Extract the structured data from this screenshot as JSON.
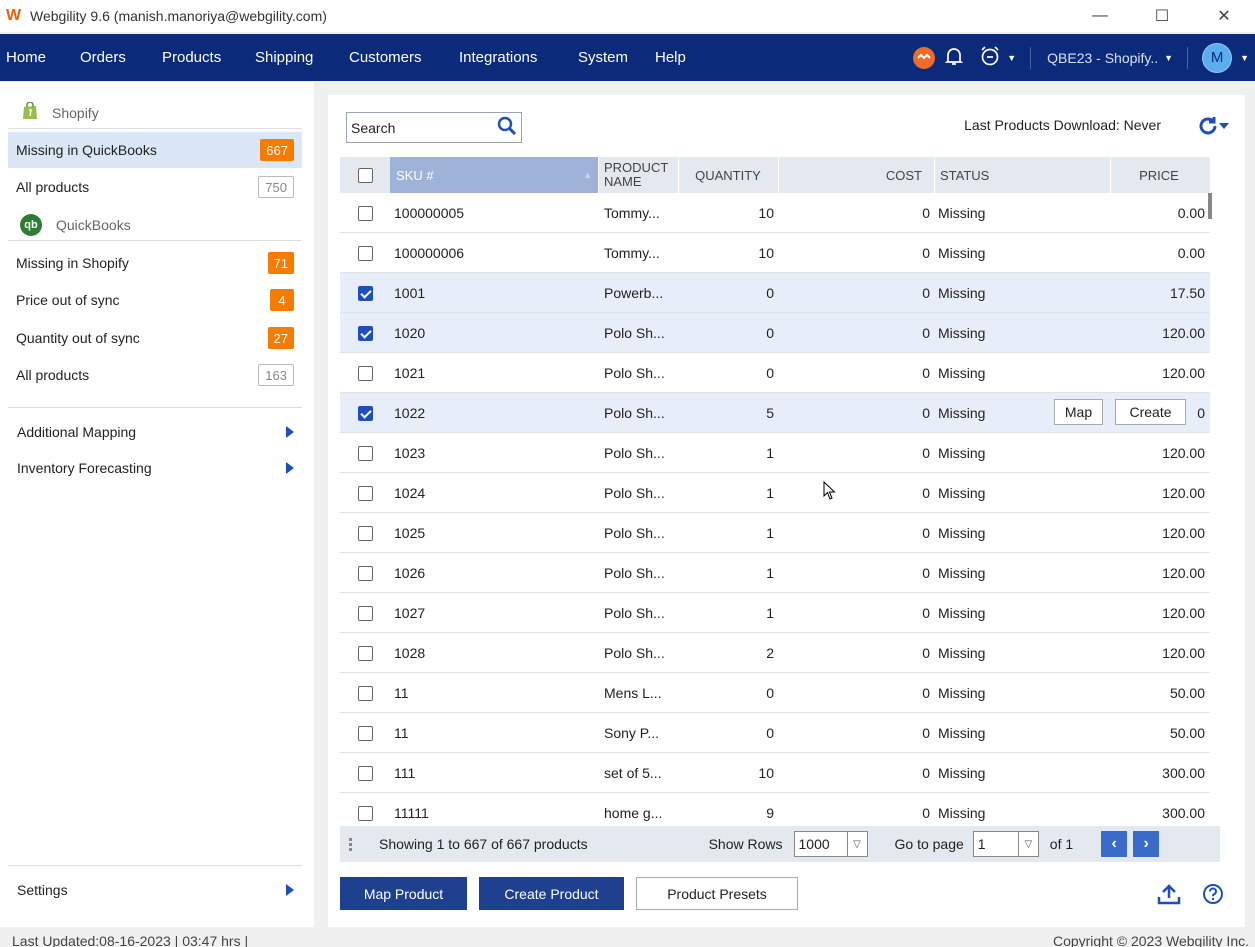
{
  "window": {
    "title": "Webgility 9.6 (manish.manoriya@webgility.com)",
    "minimize": "—",
    "maximize": "☐",
    "close": "✕"
  },
  "nav": {
    "items": [
      "Home",
      "Orders",
      "Products",
      "Shipping",
      "Customers",
      "Integrations",
      "System",
      "Help"
    ],
    "company": "QBE23 - Shopify..",
    "avatar": "M"
  },
  "sidebar": {
    "shopify_header": "Shopify",
    "quickbooks_header": "QuickBooks",
    "shopify_items": [
      {
        "label": "Missing in QuickBooks",
        "count": "667"
      },
      {
        "label": "All products",
        "count": "750"
      }
    ],
    "qb_items": [
      {
        "label": "Missing in Shopify",
        "count": "71"
      },
      {
        "label": "Price out of sync",
        "count": "4"
      },
      {
        "label": "Quantity out of sync",
        "count": "27"
      },
      {
        "label": "All products",
        "count": "163"
      }
    ],
    "additional_mapping": "Additional Mapping",
    "inventory_forecasting": "Inventory Forecasting",
    "settings": "Settings"
  },
  "toolbar": {
    "search_placeholder": "Search",
    "last_download": "Last Products Download: Never"
  },
  "table": {
    "headers": {
      "sku": "SKU #",
      "product_name_1": "PRODUCT",
      "product_name_2": "NAME",
      "quantity": "QUANTITY",
      "cost": "COST",
      "status": "STATUS",
      "price": "PRICE"
    },
    "rows": [
      {
        "checked": false,
        "sku": "100000005",
        "name": "Tommy...",
        "qty": "10",
        "cost": "0",
        "status": "Missing",
        "price": "0.00"
      },
      {
        "checked": false,
        "sku": "100000006",
        "name": "Tommy...",
        "qty": "10",
        "cost": "0",
        "status": "Missing",
        "price": "0.00"
      },
      {
        "checked": true,
        "sku": "1001",
        "name": "Powerb...",
        "qty": "0",
        "cost": "0",
        "status": "Missing",
        "price": "17.50"
      },
      {
        "checked": true,
        "sku": "1020",
        "name": "Polo Sh...",
        "qty": "0",
        "cost": "0",
        "status": "Missing",
        "price": "120.00"
      },
      {
        "checked": false,
        "sku": "1021",
        "name": "Polo Sh...",
        "qty": "0",
        "cost": "0",
        "status": "Missing",
        "price": "120.00"
      },
      {
        "checked": true,
        "sku": "1022",
        "name": "Polo Sh...",
        "qty": "5",
        "cost": "0",
        "status": "Missing",
        "price": "0",
        "hover": true
      },
      {
        "checked": false,
        "sku": "1023",
        "name": "Polo Sh...",
        "qty": "1",
        "cost": "0",
        "status": "Missing",
        "price": "120.00"
      },
      {
        "checked": false,
        "sku": "1024",
        "name": "Polo Sh...",
        "qty": "1",
        "cost": "0",
        "status": "Missing",
        "price": "120.00"
      },
      {
        "checked": false,
        "sku": "1025",
        "name": "Polo Sh...",
        "qty": "1",
        "cost": "0",
        "status": "Missing",
        "price": "120.00"
      },
      {
        "checked": false,
        "sku": "1026",
        "name": "Polo Sh...",
        "qty": "1",
        "cost": "0",
        "status": "Missing",
        "price": "120.00"
      },
      {
        "checked": false,
        "sku": "1027",
        "name": "Polo Sh...",
        "qty": "1",
        "cost": "0",
        "status": "Missing",
        "price": "120.00"
      },
      {
        "checked": false,
        "sku": "1028",
        "name": "Polo Sh...",
        "qty": "2",
        "cost": "0",
        "status": "Missing",
        "price": "120.00"
      },
      {
        "checked": false,
        "sku": "11",
        "name": "Mens L...",
        "qty": "0",
        "cost": "0",
        "status": "Missing",
        "price": "50.00"
      },
      {
        "checked": false,
        "sku": "11",
        "name": "Sony P...",
        "qty": "0",
        "cost": "0",
        "status": "Missing",
        "price": "50.00"
      },
      {
        "checked": false,
        "sku": "111",
        "name": "set of 5...",
        "qty": "10",
        "cost": "0",
        "status": "Missing",
        "price": "300.00"
      },
      {
        "checked": false,
        "sku": "11111",
        "name": "home g...",
        "qty": "9",
        "cost": "0",
        "status": "Missing",
        "price": "300.00"
      }
    ],
    "row_actions": {
      "map": "Map",
      "create": "Create"
    }
  },
  "pager": {
    "showing": "Showing 1 to 667 of 667 products",
    "show_rows_label": "Show Rows",
    "show_rows_value": "1000",
    "goto_label": "Go to page",
    "goto_value": "1",
    "of_label": "of 1"
  },
  "actions": {
    "map_product": "Map Product",
    "create_product": "Create Product",
    "product_presets": "Product Presets"
  },
  "status": {
    "last_updated": "Last Updated:08-16-2023 | 03:47 hrs |",
    "copyright": "Copyright © 2023 Webgility Inc."
  },
  "colors": {
    "nav_bg": "#0b2a7a",
    "badge": "#f57c00",
    "primary_button": "#1f3f8f",
    "accent": "#1e4fb8"
  }
}
